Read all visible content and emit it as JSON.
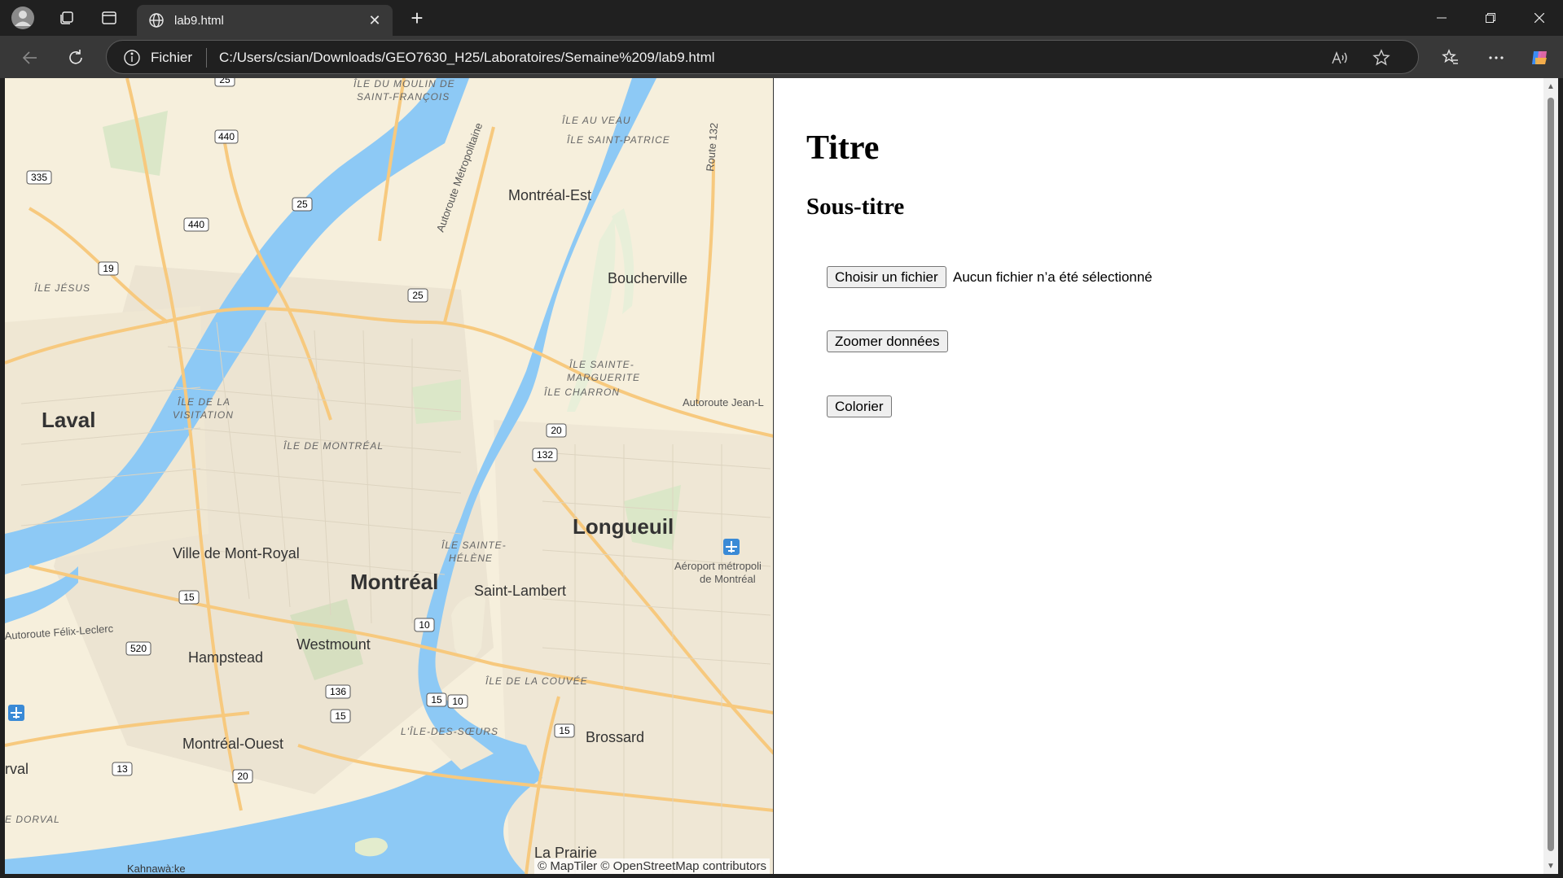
{
  "browser": {
    "tab_title": "lab9.html",
    "scheme_label": "Fichier",
    "url": "C:/Users/csian/Downloads/GEO7630_H25/Laboratoires/Semaine%209/lab9.html",
    "new_tab_symbol": "+",
    "close_symbol": "✕"
  },
  "page": {
    "title": "Titre",
    "subtitle": "Sous-titre",
    "file_button": "Choisir un fichier",
    "file_status": "Aucun fichier n’a été sélectionné",
    "zoom_button": "Zoomer données",
    "color_button": "Colorier"
  },
  "map": {
    "attribution": "© MapTiler © OpenStreetMap contributors",
    "labels": {
      "laval": "Laval",
      "montreal": "Montréal",
      "longueuil": "Longueuil",
      "montreal_est": "Montréal-Est",
      "boucherville": "Boucherville",
      "ville_mont_royal": "Ville de Mont-Royal",
      "saint_lambert": "Saint-Lambert",
      "westmount": "Westmount",
      "hampstead": "Hampstead",
      "montreal_ouest": "Montréal-Ouest",
      "brossard": "Brossard",
      "la_prairie": "La Prairie",
      "ile_jesus": "ÎLE JÉSUS",
      "ile_visitation_1": "ÎLE DE LA",
      "ile_visitation_2": "VISITATION",
      "ile_montreal": "ÎLE DE MONTRÉAL",
      "ile_moulin_1": "ÎLE DU MOULIN DE",
      "ile_moulin_2": "SAINT-FRANÇOIS",
      "ile_au_veau": "ÎLE AU VEAU",
      "ile_saint_patrice": "ÎLE SAINT-PATRICE",
      "ile_sainte_marguerite_1": "ÎLE SAINTE-",
      "ile_sainte_marguerite_2": "MARGUERITE",
      "ile_charron": "ÎLE CHARRON",
      "ile_sainte_helene_1": "ÎLE SAINTE-",
      "ile_sainte_helene_2": "HÉLÈNE",
      "ile_couvee": "ÎLE DE LA COUVÉE",
      "ile_soeurs": "L'ÎLE-DES-SŒURS",
      "dorval": "E DORVAL",
      "aeroport_1": "Aéroport métropoli",
      "aeroport_2": "de Montréal",
      "autoroute_metro": "Autoroute Métropolitaine",
      "autoroute_jean": "Autoroute Jean-L",
      "autoroute_felix": "Autoroute Félix-Leclerc",
      "route_132": "Route 132",
      "rval": "rval",
      "kahnawake": "Kahnawà:ke",
      "shields": [
        "25",
        "440",
        "335",
        "440",
        "19",
        "25",
        "25",
        "20",
        "132",
        "15",
        "10",
        "520",
        "136",
        "15",
        "15",
        "10",
        "15",
        "13",
        "20"
      ]
    }
  }
}
